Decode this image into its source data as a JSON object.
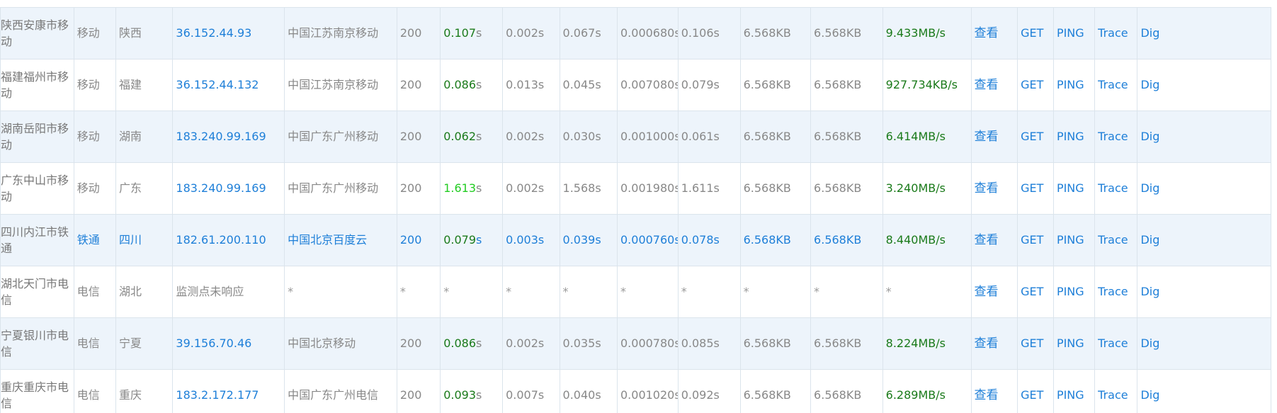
{
  "table": {
    "rows": [
      {
        "location": "陕西安康市移动",
        "isp": "移动",
        "province": "陕西",
        "ip": "36.152.44.93",
        "ip_location": "中国江苏南京移动",
        "status": "200",
        "total_time": "0.107",
        "total_unit": "s",
        "dns": "0.002s",
        "connect": "0.067s",
        "ssl": "0.000680s",
        "transfer": "0.106s",
        "header_size": "6.568KB",
        "body_size": "6.568KB",
        "speed": "9.433MB/s",
        "view": "查看",
        "get": "GET",
        "ping": "PING",
        "trace": "Trace",
        "dig": "Dig",
        "style": "normal",
        "time_color": "dark"
      },
      {
        "location": "福建福州市移动",
        "isp": "移动",
        "province": "福建",
        "ip": "36.152.44.132",
        "ip_location": "中国江苏南京移动",
        "status": "200",
        "total_time": "0.086",
        "total_unit": "s",
        "dns": "0.013s",
        "connect": "0.045s",
        "ssl": "0.007080s",
        "transfer": "0.079s",
        "header_size": "6.568KB",
        "body_size": "6.568KB",
        "speed": "927.734KB/s",
        "view": "查看",
        "get": "GET",
        "ping": "PING",
        "trace": "Trace",
        "dig": "Dig",
        "style": "normal",
        "time_color": "dark"
      },
      {
        "location": "湖南岳阳市移动",
        "isp": "移动",
        "province": "湖南",
        "ip": "183.240.99.169",
        "ip_location": "中国广东广州移动",
        "status": "200",
        "total_time": "0.062",
        "total_unit": "s",
        "dns": "0.002s",
        "connect": "0.030s",
        "ssl": "0.001000s",
        "transfer": "0.061s",
        "header_size": "6.568KB",
        "body_size": "6.568KB",
        "speed": "6.414MB/s",
        "view": "查看",
        "get": "GET",
        "ping": "PING",
        "trace": "Trace",
        "dig": "Dig",
        "style": "normal",
        "time_color": "dark"
      },
      {
        "location": "广东中山市移动",
        "isp": "移动",
        "province": "广东",
        "ip": "183.240.99.169",
        "ip_location": "中国广东广州移动",
        "status": "200",
        "total_time": "1.613",
        "total_unit": "s",
        "dns": "0.002s",
        "connect": "1.568s",
        "ssl": "0.001980s",
        "transfer": "1.611s",
        "header_size": "6.568KB",
        "body_size": "6.568KB",
        "speed": "3.240MB/s",
        "view": "查看",
        "get": "GET",
        "ping": "PING",
        "trace": "Trace",
        "dig": "Dig",
        "style": "normal",
        "time_color": "light"
      },
      {
        "location": "四川内江市铁通",
        "isp": "铁通",
        "province": "四川",
        "ip": "182.61.200.110",
        "ip_location": "中国北京百度云",
        "status": "200",
        "total_time": "0.079",
        "total_unit": "s",
        "dns": "0.003s",
        "connect": "0.039s",
        "ssl": "0.000760s",
        "transfer": "0.078s",
        "header_size": "6.568KB",
        "body_size": "6.568KB",
        "speed": "8.440MB/s",
        "view": "查看",
        "get": "GET",
        "ping": "PING",
        "trace": "Trace",
        "dig": "Dig",
        "style": "highlight",
        "time_color": "dark"
      },
      {
        "location": "湖北天门市电信",
        "isp": "电信",
        "province": "湖北",
        "ip": "监测点未响应",
        "ip_location": "*",
        "status": "*",
        "total_time": "*",
        "total_unit": "",
        "dns": "*",
        "connect": "*",
        "ssl": "*",
        "transfer": "*",
        "header_size": "*",
        "body_size": "*",
        "speed": "*",
        "view": "查看",
        "get": "GET",
        "ping": "PING",
        "trace": "Trace",
        "dig": "Dig",
        "style": "failed",
        "time_color": "none"
      },
      {
        "location": "宁夏银川市电信",
        "isp": "电信",
        "province": "宁夏",
        "ip": "39.156.70.46",
        "ip_location": "中国北京移动",
        "status": "200",
        "total_time": "0.086",
        "total_unit": "s",
        "dns": "0.002s",
        "connect": "0.035s",
        "ssl": "0.000780s",
        "transfer": "0.085s",
        "header_size": "6.568KB",
        "body_size": "6.568KB",
        "speed": "8.224MB/s",
        "view": "查看",
        "get": "GET",
        "ping": "PING",
        "trace": "Trace",
        "dig": "Dig",
        "style": "normal",
        "time_color": "dark"
      },
      {
        "location": "重庆重庆市电信",
        "isp": "电信",
        "province": "重庆",
        "ip": "183.2.172.177",
        "ip_location": "中国广东广州电信",
        "status": "200",
        "total_time": "0.093",
        "total_unit": "s",
        "dns": "0.007s",
        "connect": "0.040s",
        "ssl": "0.001020s",
        "transfer": "0.092s",
        "header_size": "6.568KB",
        "body_size": "6.568KB",
        "speed": "6.289MB/s",
        "view": "查看",
        "get": "GET",
        "ping": "PING",
        "trace": "Trace",
        "dig": "Dig",
        "style": "normal",
        "time_color": "dark"
      }
    ]
  },
  "colors": {
    "link": "#1e7fd8",
    "speed_green": "#1a7a1a",
    "time_light_green": "#22cc22",
    "muted_text": "#888888",
    "odd_row_bg": "#edf4fb",
    "border": "#dbe4ec"
  }
}
